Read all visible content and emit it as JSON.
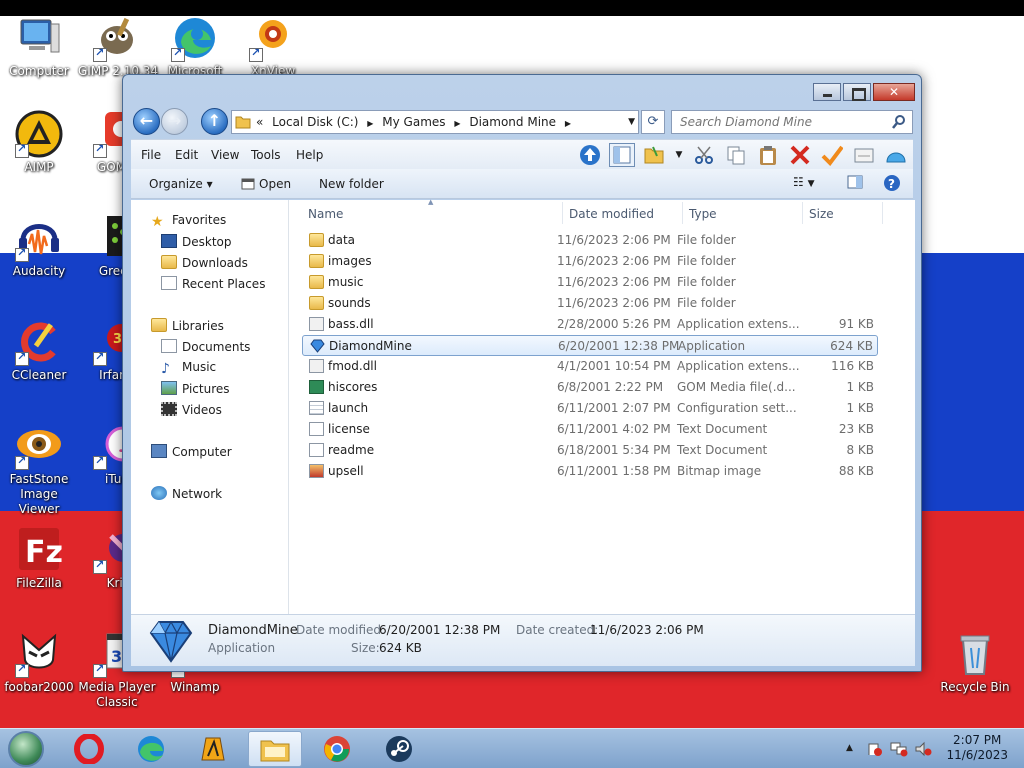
{
  "desktop": {
    "icons": [
      {
        "label": "Computer"
      },
      {
        "label": "GIMP 2.10.34"
      },
      {
        "label": "Microsoft"
      },
      {
        "label": "XnView"
      },
      {
        "label": "AIMP"
      },
      {
        "label": "GOM P"
      },
      {
        "label": "Audacity"
      },
      {
        "label": "Green"
      },
      {
        "label": "CCleaner"
      },
      {
        "label": "IrfanV"
      },
      {
        "label": "FastStone Image Viewer"
      },
      {
        "label": "iTun"
      },
      {
        "label": "FileZilla"
      },
      {
        "label": "Krit"
      },
      {
        "label": "foobar2000"
      },
      {
        "label": "Media Player Classic"
      },
      {
        "label": "Winamp"
      },
      {
        "label": "Recycle Bin"
      }
    ]
  },
  "window": {
    "breadcrumbs": [
      "«",
      "Local Disk (C:)",
      "▶",
      "My Games",
      "▶",
      "Diamond Mine",
      "▶"
    ],
    "search_placeholder": "Search Diamond Mine",
    "menu": [
      "File",
      "Edit",
      "View",
      "Tools",
      "Help"
    ],
    "commands": {
      "organize": "Organize ▾",
      "open": "Open",
      "new_folder": "New folder"
    },
    "nav": {
      "favorites": "Favorites",
      "desktop": "Desktop",
      "downloads": "Downloads",
      "recent": "Recent Places",
      "libraries": "Libraries",
      "documents": "Documents",
      "music": "Music",
      "pictures": "Pictures",
      "videos": "Videos",
      "computer": "Computer",
      "network": "Network"
    },
    "columns": {
      "name": "Name",
      "date": "Date modified",
      "type": "Type",
      "size": "Size"
    },
    "files": [
      {
        "name": "data",
        "date": "11/6/2023 2:06 PM",
        "type": "File folder",
        "size": "",
        "icon": "folder"
      },
      {
        "name": "images",
        "date": "11/6/2023 2:06 PM",
        "type": "File folder",
        "size": "",
        "icon": "folder"
      },
      {
        "name": "music",
        "date": "11/6/2023 2:06 PM",
        "type": "File folder",
        "size": "",
        "icon": "folder"
      },
      {
        "name": "sounds",
        "date": "11/6/2023 2:06 PM",
        "type": "File folder",
        "size": "",
        "icon": "folder"
      },
      {
        "name": "bass.dll",
        "date": "2/28/2000 5:26 PM",
        "type": "Application extens...",
        "size": "91 KB",
        "icon": "dll"
      },
      {
        "name": "DiamondMine",
        "date": "6/20/2001 12:38 PM",
        "type": "Application",
        "size": "624 KB",
        "icon": "diamond"
      },
      {
        "name": "fmod.dll",
        "date": "4/1/2001 10:54 PM",
        "type": "Application extens...",
        "size": "116 KB",
        "icon": "dll"
      },
      {
        "name": "hiscores",
        "date": "6/8/2001 2:22 PM",
        "type": "GOM Media file(.d...",
        "size": "1 KB",
        "icon": "dat"
      },
      {
        "name": "launch",
        "date": "6/11/2001 2:07 PM",
        "type": "Configuration sett...",
        "size": "1 KB",
        "icon": "cfg"
      },
      {
        "name": "license",
        "date": "6/11/2001 4:02 PM",
        "type": "Text Document",
        "size": "23 KB",
        "icon": "txt"
      },
      {
        "name": "readme",
        "date": "6/18/2001 5:34 PM",
        "type": "Text Document",
        "size": "8 KB",
        "icon": "txt"
      },
      {
        "name": "upsell",
        "date": "6/11/2001 1:58 PM",
        "type": "Bitmap image",
        "size": "88 KB",
        "icon": "bmp"
      }
    ],
    "details": {
      "name": "DiamondMine",
      "type": "Application",
      "modified_label": "Date modified:",
      "modified": "6/20/2001 12:38 PM",
      "created_label": "Date created:",
      "created": "11/6/2023 2:06 PM",
      "size_label": "Size:",
      "size": "624 KB"
    }
  },
  "taskbar": {
    "time": "2:07 PM",
    "date": "11/6/2023"
  },
  "colors": {
    "flag_white": "#ffffff",
    "flag_blue": "#1540c8",
    "flag_red": "#e0262a",
    "selection": "#dcebfc"
  }
}
